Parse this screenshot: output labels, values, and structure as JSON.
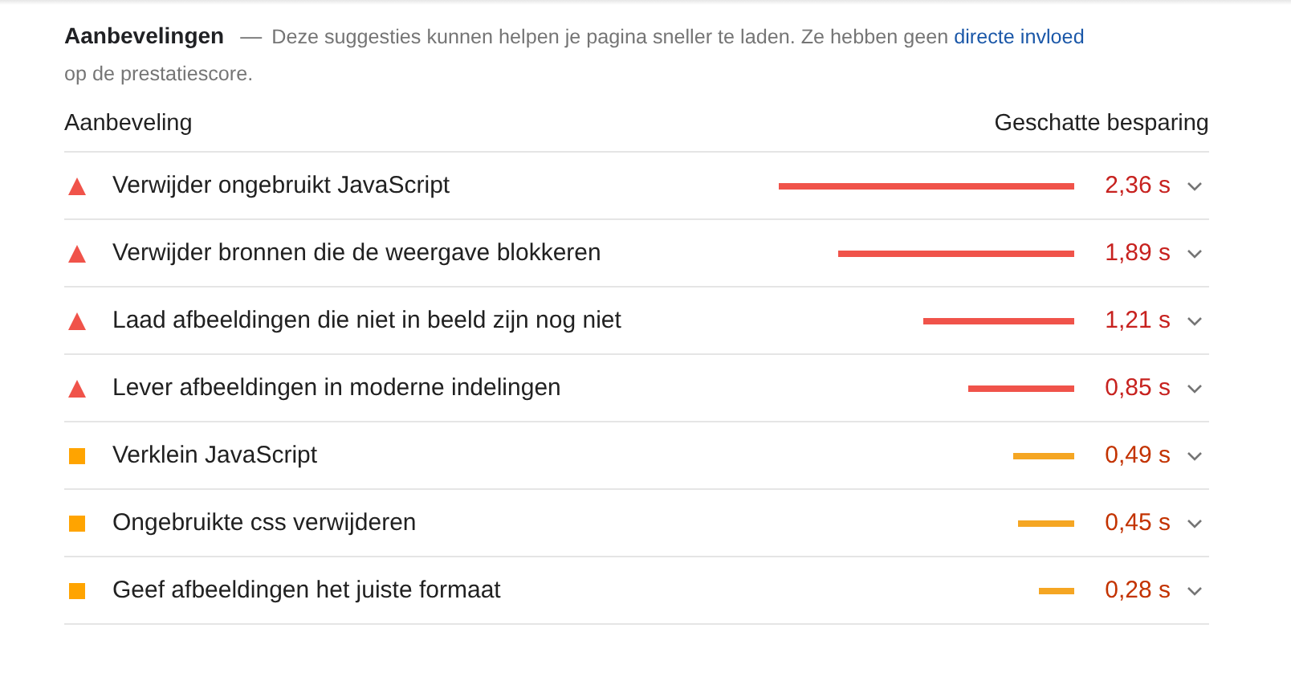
{
  "section": {
    "title": "Aanbevelingen",
    "dash": "—",
    "description_start": "Deze suggesties kunnen helpen je pagina sneller te laden. Ze hebben geen",
    "link": "directe invloed",
    "description_end": "op de prestatiescore."
  },
  "columns": [
    "Aanbeveling",
    "Geschatte besparing"
  ],
  "rows": [
    {
      "kind": "fail",
      "label": "Verwijder ongebruikt JavaScript",
      "saving": "2,36 s",
      "expanded": false
    },
    {
      "kind": "fail",
      "label": "Verwijder bronnen die de weergave blokkeren",
      "saving": "1,89 s",
      "expanded": false
    },
    {
      "kind": "fail",
      "label": "Laad afbeeldingen die niet in beeld zijn nog niet",
      "saving": "1,21 s",
      "expanded": false
    },
    {
      "kind": "fail",
      "label": "Lever afbeeldingen in moderne indelingen",
      "saving": "0,85 s",
      "expanded": false
    },
    {
      "kind": "average",
      "label": "Verklein JavaScript",
      "saving": "0,49 s",
      "expanded": false
    },
    {
      "kind": "average",
      "label": "Ongebruikte css verwijderen",
      "saving": "0,45 s",
      "expanded": false
    },
    {
      "kind": "average",
      "label": "Geef afbeeldingen het juiste formaat",
      "saving": "0,28 s",
      "expanded": false
    }
  ]
}
